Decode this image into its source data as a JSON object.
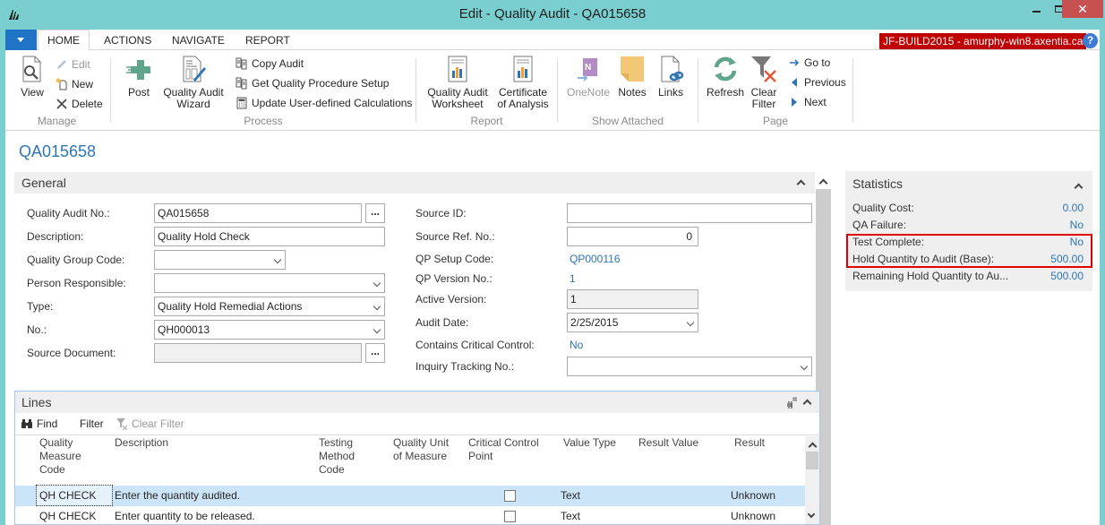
{
  "window": {
    "title": "Edit - Quality Audit - QA015658",
    "server_badge": "JF-BUILD2015 - amurphy-win8.axentia.ca",
    "close_glyph": "✕"
  },
  "tabs": [
    {
      "label": "HOME",
      "active": true
    },
    {
      "label": "ACTIONS",
      "active": false
    },
    {
      "label": "NAVIGATE",
      "active": false
    },
    {
      "label": "REPORT",
      "active": false
    }
  ],
  "ribbon": {
    "manage": {
      "label": "Manage",
      "view": "View",
      "edit": "Edit",
      "new": "New",
      "delete": "Delete"
    },
    "process": {
      "label": "Process",
      "post": "Post",
      "wizard": "Quality Audit Wizard",
      "wizard_line1": "Quality Audit",
      "wizard_line2": "Wizard",
      "copy_audit": "Copy Audit",
      "get_setup": "Get Quality Procedure Setup",
      "update_calc": "Update User-defined Calculations"
    },
    "report": {
      "label": "Report",
      "worksheet_line1": "Quality Audit",
      "worksheet_line2": "Worksheet",
      "coa_line1": "Certificate",
      "coa_line2": "of Analysis"
    },
    "show_attached": {
      "label": "Show Attached",
      "onenote": "OneNote",
      "notes": "Notes",
      "links": "Links"
    },
    "page": {
      "label": "Page",
      "refresh": "Refresh",
      "clear_filter_line1": "Clear",
      "clear_filter_line2": "Filter",
      "goto": "Go to",
      "previous": "Previous",
      "next": "Next"
    }
  },
  "page_title": "QA015658",
  "general": {
    "header": "General",
    "left": [
      {
        "label": "Quality Audit No.:",
        "value": "QA015658"
      },
      {
        "label": "Description:",
        "value": "Quality Hold Check"
      },
      {
        "label": "Quality Group Code:",
        "value": ""
      },
      {
        "label": "Person Responsible:",
        "value": ""
      },
      {
        "label": "Type:",
        "value": "Quality Hold Remedial Actions"
      },
      {
        "label": "No.:",
        "value": "QH000013"
      },
      {
        "label": "Source Document:",
        "value": ""
      }
    ],
    "right": [
      {
        "label": "Source ID:",
        "value": ""
      },
      {
        "label": "Source Ref. No.:",
        "value": "0"
      },
      {
        "label": "QP Setup Code:",
        "value": "QP000116"
      },
      {
        "label": "QP Version No.:",
        "value": "1"
      },
      {
        "label": "Active Version:",
        "value": "1"
      },
      {
        "label": "Audit Date:",
        "value": "2/25/2015"
      },
      {
        "label": "Contains Critical Control:",
        "value": "No"
      },
      {
        "label": "Inquiry Tracking No.:",
        "value": ""
      }
    ]
  },
  "statistics": {
    "title": "Statistics",
    "rows": [
      {
        "label": "Quality Cost:",
        "value": "0.00"
      },
      {
        "label": "QA Failure:",
        "value": "No"
      },
      {
        "label": "Test Complete:",
        "value": "No"
      },
      {
        "label": "Hold Quantity to Audit (Base):",
        "value": "500.00"
      },
      {
        "label": "Remaining Hold Quantity to Au...",
        "value": "500.00"
      }
    ],
    "highlight_color": "#e00000"
  },
  "lines": {
    "header": "Lines",
    "toolbar": {
      "find": "Find",
      "filter": "Filter",
      "clear_filter": "Clear Filter"
    },
    "columns": [
      "Quality\nMeasure\nCode",
      "Description",
      "Testing\nMethod\nCode",
      "Quality Unit\nof Measure",
      "Critical Control\nPoint",
      "Value Type",
      "Result Value",
      "Result"
    ],
    "rows": [
      {
        "code": "QH CHECK",
        "description": "Enter the quantity audited.",
        "testing_method": "",
        "uom": "",
        "critical": false,
        "value_type": "Text",
        "result_value": "",
        "result": "Unknown",
        "selected": true
      },
      {
        "code": "QH CHECK",
        "description": "Enter quantity to be released.",
        "testing_method": "",
        "uom": "",
        "critical": false,
        "value_type": "Text",
        "result_value": "",
        "result": "Unknown",
        "selected": false
      }
    ]
  },
  "colors": {
    "titlebar": "#79cfcf",
    "accent_blue": "#2e75b6",
    "menu_blue": "#1f74c8",
    "server_badge_bg": "#c00000",
    "close_btn": "#c75050",
    "selected_row": "#cce4f7"
  }
}
